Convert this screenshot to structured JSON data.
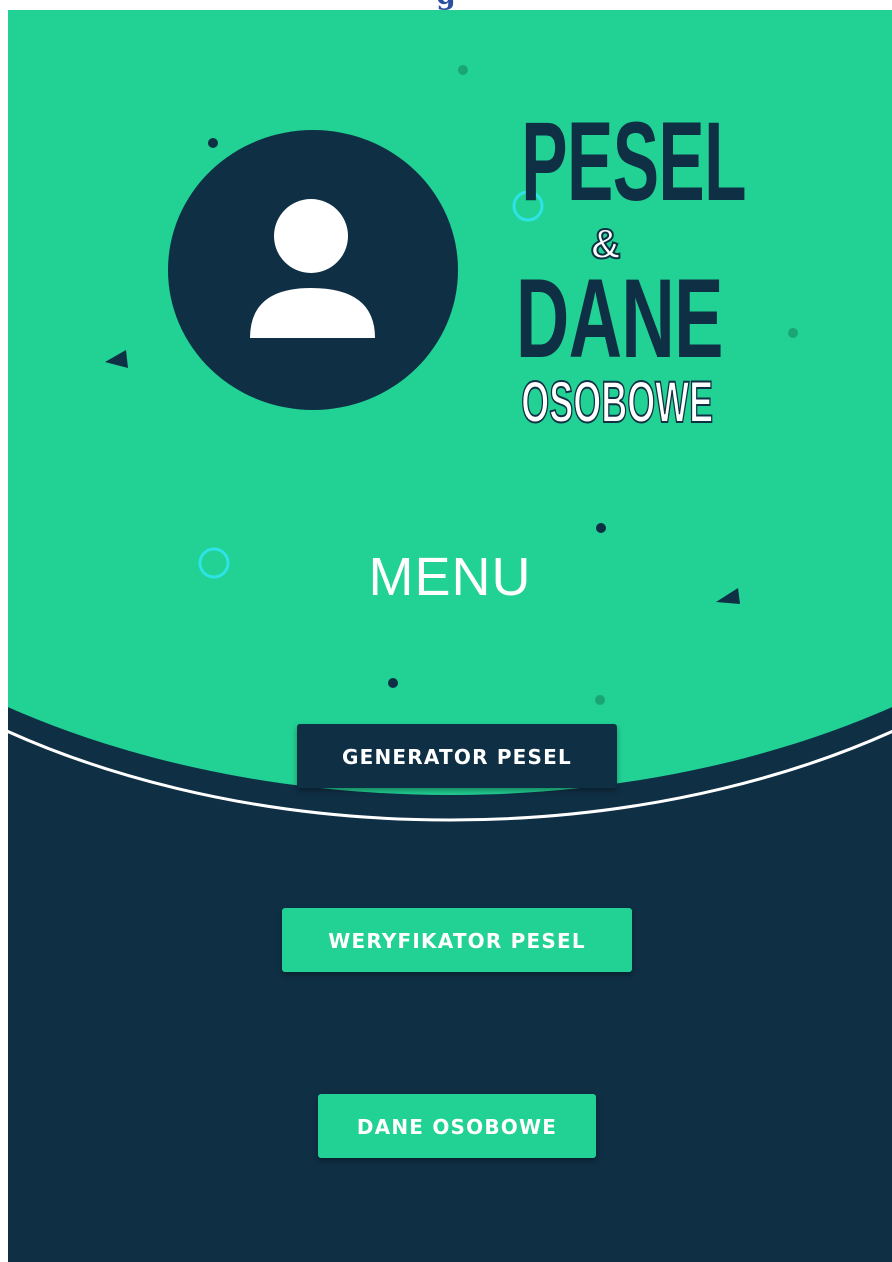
{
  "header": {
    "partial_title": "g"
  },
  "logo": {
    "line1": "PESEL",
    "amp": "&",
    "line2": "DANE",
    "line3": "OSOBOWE"
  },
  "menu": {
    "title": "MENU"
  },
  "buttons": {
    "generator": "GENERATOR PESEL",
    "weryfikator": "WERYFIKATOR PESEL",
    "dane": "DANE OSOBOWE"
  },
  "colors": {
    "accent_green": "#22d194",
    "navy": "#0f2f45",
    "white": "#ffffff"
  },
  "icons": [
    "user-avatar-icon"
  ]
}
